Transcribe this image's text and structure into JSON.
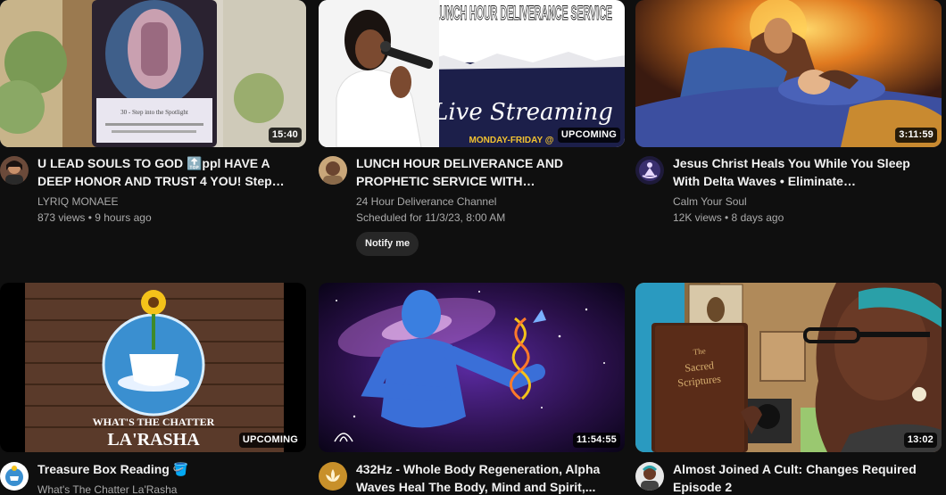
{
  "videos": [
    {
      "title": "U LEAD SOULS TO GOD 🔝ppl HAVE A DEEP HONOR AND TRUST 4 YOU! Step into the Spotlight",
      "channel": "LYRIQ MONAEE",
      "stats": "873 views • 9 hours ago",
      "badge": "15:40",
      "avatar_icon": "profile-photo-icon",
      "thumb_text": "30 - Step into the Spotlight"
    },
    {
      "title": "LUNCH HOUR DELIVERANCE AND PROPHETIC SERVICE WITH PROPHETESS...",
      "channel": "24 Hour Deliverance Channel",
      "stats": "Scheduled for 11/3/23, 8:00 AM",
      "badge": "UPCOMING",
      "button": "Notify me",
      "avatar_icon": "profile-photo-icon",
      "thumb_heading": "LUNCH HOUR DELIVERANCE SERVICE",
      "thumb_script": "Live Streaming",
      "thumb_sub": "MONDAY-FRIDAY @"
    },
    {
      "title": "Jesus Christ Heals You While You Sleep With Delta Waves • Eliminate Subconscious Negativity",
      "channel": "Calm Your Soul",
      "stats": "12K views • 8 days ago",
      "badge": "3:11:59",
      "avatar_icon": "meditation-figure-icon"
    },
    {
      "title": "Treasure Box Reading 🪣",
      "channel": "What's The Chatter La'Rasha",
      "stats": "",
      "badge": "UPCOMING",
      "avatar_icon": "teacup-logo-icon",
      "thumb_text_1": "WHAT'S THE CHATTER",
      "thumb_text_2": "LA'RASHA"
    },
    {
      "title": "432Hz - Whole Body Regeneration, Alpha Waves Heal The Body, Mind and Spirit,...",
      "channel": "",
      "stats": "",
      "badge": "11:54:55",
      "avatar_icon": "lotus-icon"
    },
    {
      "title": "Almost Joined A Cult: Changes Required Episode 2",
      "channel": "",
      "stats": "",
      "badge": "13:02",
      "avatar_icon": "profile-photo-icon",
      "thumb_book_1": "The",
      "thumb_book_2": "Sacred",
      "thumb_book_3": "Scriptures"
    }
  ],
  "colors": {
    "background": "#0f0f0f",
    "title": "#f1f1f1",
    "secondary": "#aaaaaa",
    "badge_bg": "#000000",
    "button_bg": "#272727"
  }
}
